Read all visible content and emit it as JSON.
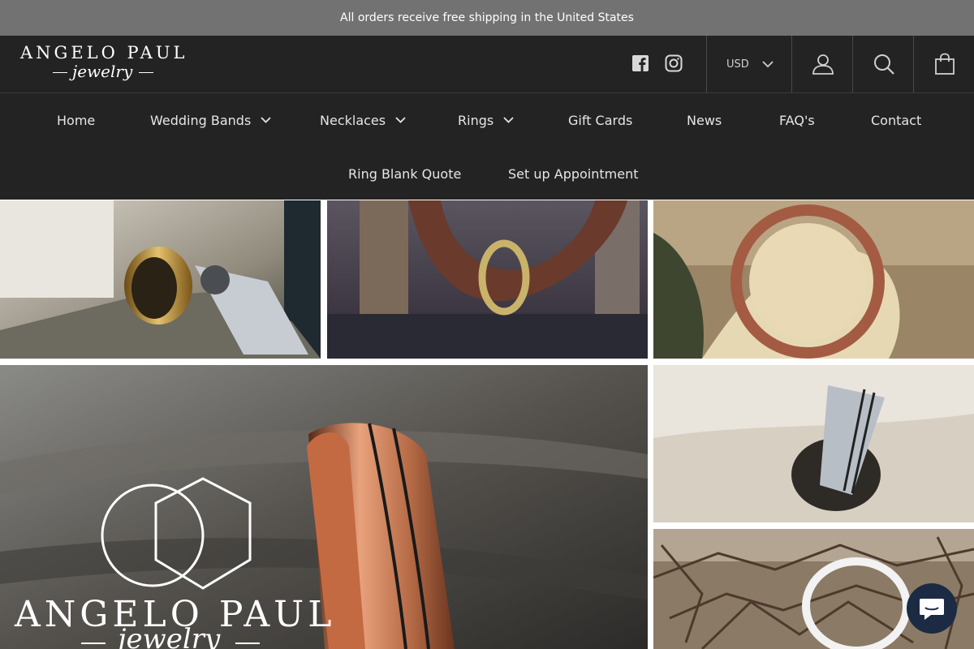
{
  "announcement": "All orders receive free shipping in the United States",
  "logo": {
    "brand": "ANGELO PAUL",
    "script": "jewelry"
  },
  "social": [
    "facebook-icon",
    "instagram-icon"
  ],
  "currency": {
    "selected": "USD"
  },
  "header_icons": [
    "account-icon",
    "search-icon",
    "cart-icon"
  ],
  "nav": {
    "row1": [
      {
        "label": "Home",
        "dropdown": false
      },
      {
        "label": "Wedding Bands",
        "dropdown": true
      },
      {
        "label": "Necklaces",
        "dropdown": true
      },
      {
        "label": "Rings",
        "dropdown": true
      },
      {
        "label": "Gift Cards",
        "dropdown": false
      },
      {
        "label": "News",
        "dropdown": false
      },
      {
        "label": "FAQ's",
        "dropdown": false
      },
      {
        "label": "Contact",
        "dropdown": false
      }
    ],
    "row2": [
      {
        "label": "Ring Blank Quote",
        "dropdown": false
      },
      {
        "label": "Set up Appointment",
        "dropdown": false
      }
    ]
  },
  "gallery": {
    "overlay_brand": "ANGELO PAUL",
    "overlay_script": "jewelry"
  },
  "colors": {
    "announce_bg": "#727272",
    "header_bg": "#232323",
    "chat_bg": "#1c2a44"
  }
}
